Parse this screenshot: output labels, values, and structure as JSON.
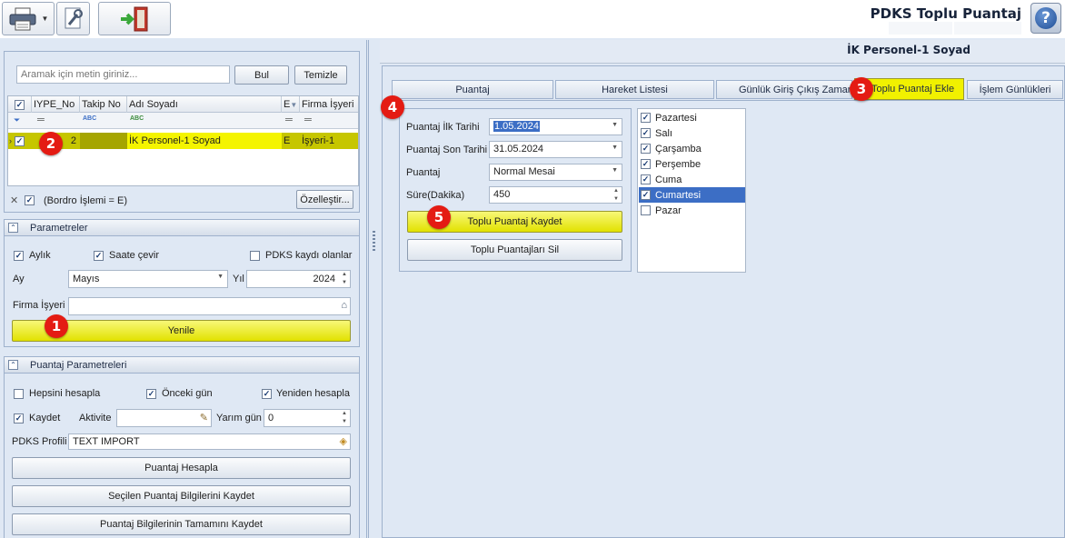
{
  "window_title": "PDKS Toplu Puantaj",
  "person_header": "İK Personel-1 Soyad",
  "search": {
    "placeholder": "Aramak için metin giriniz...",
    "find_label": "Bul",
    "clear_label": "Temizle"
  },
  "grid": {
    "columns": [
      "IYPE_No",
      "Takip No",
      "Adı Soyadı",
      "E",
      "Firma İşyeri"
    ],
    "row": {
      "iype_no": "2",
      "takip_no": "",
      "adi_soyadi": "İK Personel-1 Soyad",
      "e": "E",
      "firma": "İşyeri-1"
    },
    "filter_text": "(Bordro İşlemi = E)",
    "customize_label": "Özelleştir..."
  },
  "parametreler": {
    "title": "Parametreler",
    "aylik_label": "Aylık",
    "saate_cevir_label": "Saate çevir",
    "pdks_kaydi_label": "PDKS kaydı olanlar",
    "ay_label": "Ay",
    "ay_value": "Mayıs",
    "yil_label": "Yıl",
    "yil_value": "2024",
    "firma_label": "Firma İşyeri",
    "firma_value": "",
    "refresh_label": "Yenile"
  },
  "puantaj_parametreleri": {
    "title": "Puantaj Parametreleri",
    "hepsini_label": "Hepsini hesapla",
    "onceki_label": "Önceki gün",
    "yeniden_label": "Yeniden hesapla",
    "kaydet_label": "Kaydet",
    "aktivite_label": "Aktivite",
    "aktivite_value": "",
    "yarim_gun_label": "Yarım gün",
    "yarim_gun_value": "0",
    "profil_label": "PDKS Profili",
    "profil_value": "TEXT IMPORT",
    "hesapla_label": "Puantaj Hesapla",
    "secilen_kaydet_label": "Seçilen Puantaj Bilgilerini Kaydet",
    "tamami_kaydet_label": "Puantaj Bilgilerinin Tamamını Kaydet"
  },
  "tabs": [
    "Puantaj",
    "Hareket Listesi",
    "Günlük Giriş Çıkış Zamanları",
    "Toplu Puantaj Ekle",
    "İşlem Günlükleri"
  ],
  "form": {
    "ilk_tarih_label": "Puantaj İlk Tarihi",
    "ilk_tarih_value": "1.05.2024",
    "son_tarih_label": "Puantaj Son Tarihi",
    "son_tarih_value": "31.05.2024",
    "puantaj_label": "Puantaj",
    "puantaj_value": "Normal Mesai",
    "sure_label": "Süre(Dakika)",
    "sure_value": "450",
    "kaydet_label": "Toplu Puantaj Kaydet",
    "sil_label": "Toplu Puantajları Sil"
  },
  "days": [
    {
      "label": "Pazartesi",
      "checked": true
    },
    {
      "label": "Salı",
      "checked": true
    },
    {
      "label": "Çarşamba",
      "checked": true
    },
    {
      "label": "Perşembe",
      "checked": true
    },
    {
      "label": "Cuma",
      "checked": true
    },
    {
      "label": "Cumartesi",
      "checked": true
    },
    {
      "label": "Pazar",
      "checked": false
    }
  ],
  "callouts": [
    "1",
    "2",
    "3",
    "4",
    "5"
  ],
  "colors": {
    "highlight": "#e2e200",
    "callout": "#e41b13",
    "selection": "#3c6ec5"
  }
}
